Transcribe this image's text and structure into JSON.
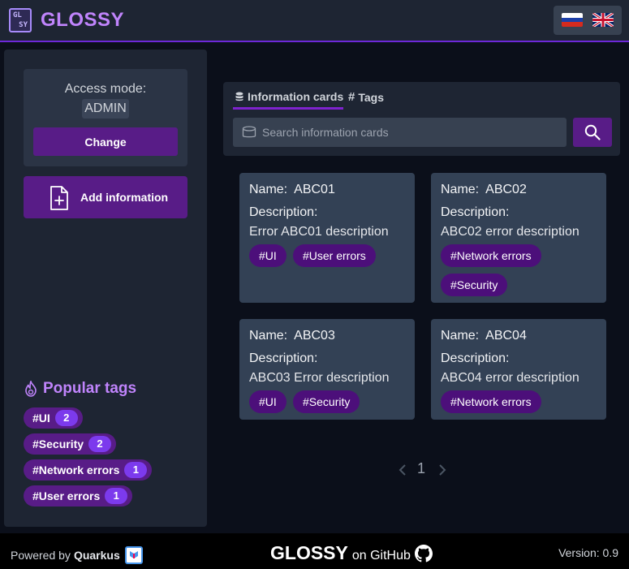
{
  "header": {
    "logo_letters": [
      "GL",
      "SY"
    ],
    "brand": "GLOSSY",
    "languages": [
      {
        "code": "ru",
        "icon": "russia-flag-icon"
      },
      {
        "code": "en",
        "icon": "uk-flag-icon"
      }
    ]
  },
  "sidebar": {
    "access_label": "Access mode:",
    "access_value": "ADMIN",
    "change_label": "Change",
    "add_label": "Add information",
    "popular_title": "Popular tags",
    "popular_tags": [
      {
        "label": "#UI",
        "count": "2"
      },
      {
        "label": "#Security",
        "count": "2"
      },
      {
        "label": "#Network errors",
        "count": "1"
      },
      {
        "label": "#User errors",
        "count": "1"
      }
    ]
  },
  "search": {
    "tabs": [
      {
        "label": "Information cards",
        "icon": "database-icon",
        "active": true
      },
      {
        "label": "Tags",
        "icon": "hash-icon",
        "active": false
      }
    ],
    "placeholder": "Search information cards",
    "value": ""
  },
  "cards": [
    {
      "name_label": "Name:",
      "name": "ABC01",
      "desc_label": "Description:",
      "description": "Error ABC01 description",
      "tags": [
        "#UI",
        "#User errors"
      ]
    },
    {
      "name_label": "Name:",
      "name": "ABC02",
      "desc_label": "Description:",
      "description": "ABC02 error description",
      "tags": [
        "#Network errors",
        "#Security"
      ]
    },
    {
      "name_label": "Name:",
      "name": "ABC03",
      "desc_label": "Description:",
      "description": "ABC03 Error description",
      "tags": [
        "#UI",
        "#Security"
      ]
    },
    {
      "name_label": "Name:",
      "name": "ABC04",
      "desc_label": "Description:",
      "description": "ABC04 error description",
      "tags": [
        "#Network errors"
      ]
    }
  ],
  "pagination": {
    "prev_icon": "chevron-left-icon",
    "current": "1",
    "next_icon": "chevron-right-icon"
  },
  "footer": {
    "powered_prefix": "Powered by",
    "powered_name": "Quarkus",
    "brand": "GLOSSY",
    "github_text": "on GitHub",
    "version": "Version: 0.9"
  },
  "colors": {
    "accent": "#c084fc",
    "button": "#581c87",
    "tag": "#4c0f7a",
    "card": "#334155",
    "panel": "#1e2533",
    "background": "#0b0f1a"
  }
}
